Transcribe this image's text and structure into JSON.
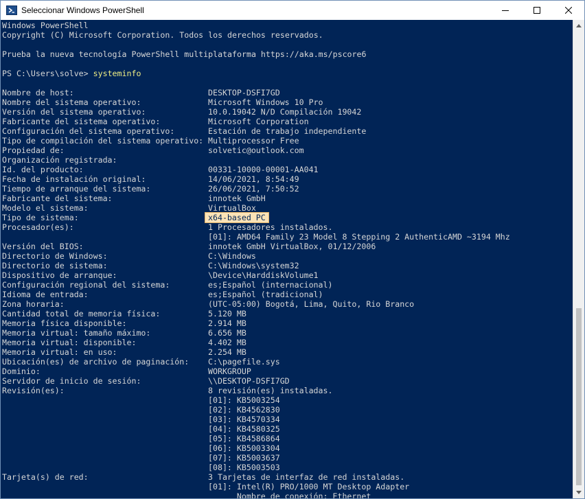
{
  "window": {
    "title": "Seleccionar Windows PowerShell"
  },
  "colors": {
    "background": "#012456",
    "text": "#d6d6d6",
    "command": "#f0ee84",
    "highlight": "#fbe3b7"
  },
  "console": {
    "header": [
      "Windows PowerShell",
      "Copyright (C) Microsoft Corporation. Todos los derechos reservados.",
      "",
      "Prueba la nueva tecnología PowerShell multiplataforma https://aka.ms/pscore6",
      ""
    ],
    "prompt": "PS C:\\Users\\solve> ",
    "command": "systeminfo",
    "rows": [
      {
        "label": "",
        "value": ""
      },
      {
        "label": "Nombre de host:",
        "value": "DESKTOP-DSFI7GD"
      },
      {
        "label": "Nombre del sistema operativo:",
        "value": "Microsoft Windows 10 Pro"
      },
      {
        "label": "Versión del sistema operativo:",
        "value": "10.0.19042 N/D Compilación 19042"
      },
      {
        "label": "Fabricante del sistema operativo:",
        "value": "Microsoft Corporation"
      },
      {
        "label": "Configuración del sistema operativo:",
        "value": "Estación de trabajo independiente"
      },
      {
        "label": "Tipo de compilación del sistema operativo:",
        "value": "Multiprocessor Free"
      },
      {
        "label": "Propiedad de:",
        "value": "solvetic@outlook.com"
      },
      {
        "label": "Organización registrada:",
        "value": ""
      },
      {
        "label": "Id. del producto:",
        "value": "00331-10000-00001-AA041"
      },
      {
        "label": "Fecha de instalación original:",
        "value": "14/06/2021, 8:54:49"
      },
      {
        "label": "Tiempo de arranque del sistema:",
        "value": "26/06/2021, 7:50:52"
      },
      {
        "label": "Fabricante del sistema:",
        "value": "innotek GmbH"
      },
      {
        "label": "Modelo el sistema:",
        "value": "VirtualBox"
      },
      {
        "label": "Tipo de sistema:",
        "value": "x64-based PC",
        "highlight": true
      },
      {
        "label": "Procesador(es):",
        "value": "1 Procesadores instalados."
      },
      {
        "label": "",
        "value": "[01]: AMD64 Family 23 Model 8 Stepping 2 AuthenticAMD ~3194 Mhz"
      },
      {
        "label": "Versión del BIOS:",
        "value": "innotek GmbH VirtualBox, 01/12/2006"
      },
      {
        "label": "Directorio de Windows:",
        "value": "C:\\Windows"
      },
      {
        "label": "Directorio de sistema:",
        "value": "C:\\Windows\\system32"
      },
      {
        "label": "Dispositivo de arranque:",
        "value": "\\Device\\HarddiskVolume1"
      },
      {
        "label": "Configuración regional del sistema:",
        "value": "es;Español (internacional)"
      },
      {
        "label": "Idioma de entrada:",
        "value": "es;Español (tradicional)"
      },
      {
        "label": "Zona horaria:",
        "value": "(UTC-05:00) Bogotá, Lima, Quito, Rio Branco"
      },
      {
        "label": "Cantidad total de memoria física:",
        "value": "5.120 MB"
      },
      {
        "label": "Memoria física disponible:",
        "value": "2.914 MB"
      },
      {
        "label": "Memoria virtual: tamaño máximo:",
        "value": "6.656 MB"
      },
      {
        "label": "Memoria virtual: disponible:",
        "value": "4.402 MB"
      },
      {
        "label": "Memoria virtual: en uso:",
        "value": "2.254 MB"
      },
      {
        "label": "Ubicación(es) de archivo de paginación:",
        "value": "C:\\pagefile.sys"
      },
      {
        "label": "Dominio:",
        "value": "WORKGROUP"
      },
      {
        "label": "Servidor de inicio de sesión:",
        "value": "\\\\DESKTOP-DSFI7GD"
      },
      {
        "label": "Revisión(es):",
        "value": "8 revisión(es) instaladas."
      },
      {
        "label": "",
        "value": "[01]: KB5003254"
      },
      {
        "label": "",
        "value": "[02]: KB4562830"
      },
      {
        "label": "",
        "value": "[03]: KB4570334"
      },
      {
        "label": "",
        "value": "[04]: KB4580325"
      },
      {
        "label": "",
        "value": "[05]: KB4586864"
      },
      {
        "label": "",
        "value": "[06]: KB5003304"
      },
      {
        "label": "",
        "value": "[07]: KB5003637"
      },
      {
        "label": "",
        "value": "[08]: KB5003503"
      },
      {
        "label": "Tarjeta(s) de red:",
        "value": "3 Tarjetas de interfaz de red instaladas."
      },
      {
        "label": "",
        "value": "[01]: Intel(R) PRO/1000 MT Desktop Adapter"
      },
      {
        "label": "",
        "value": "      Nombre de conexión: Ethernet"
      }
    ]
  }
}
